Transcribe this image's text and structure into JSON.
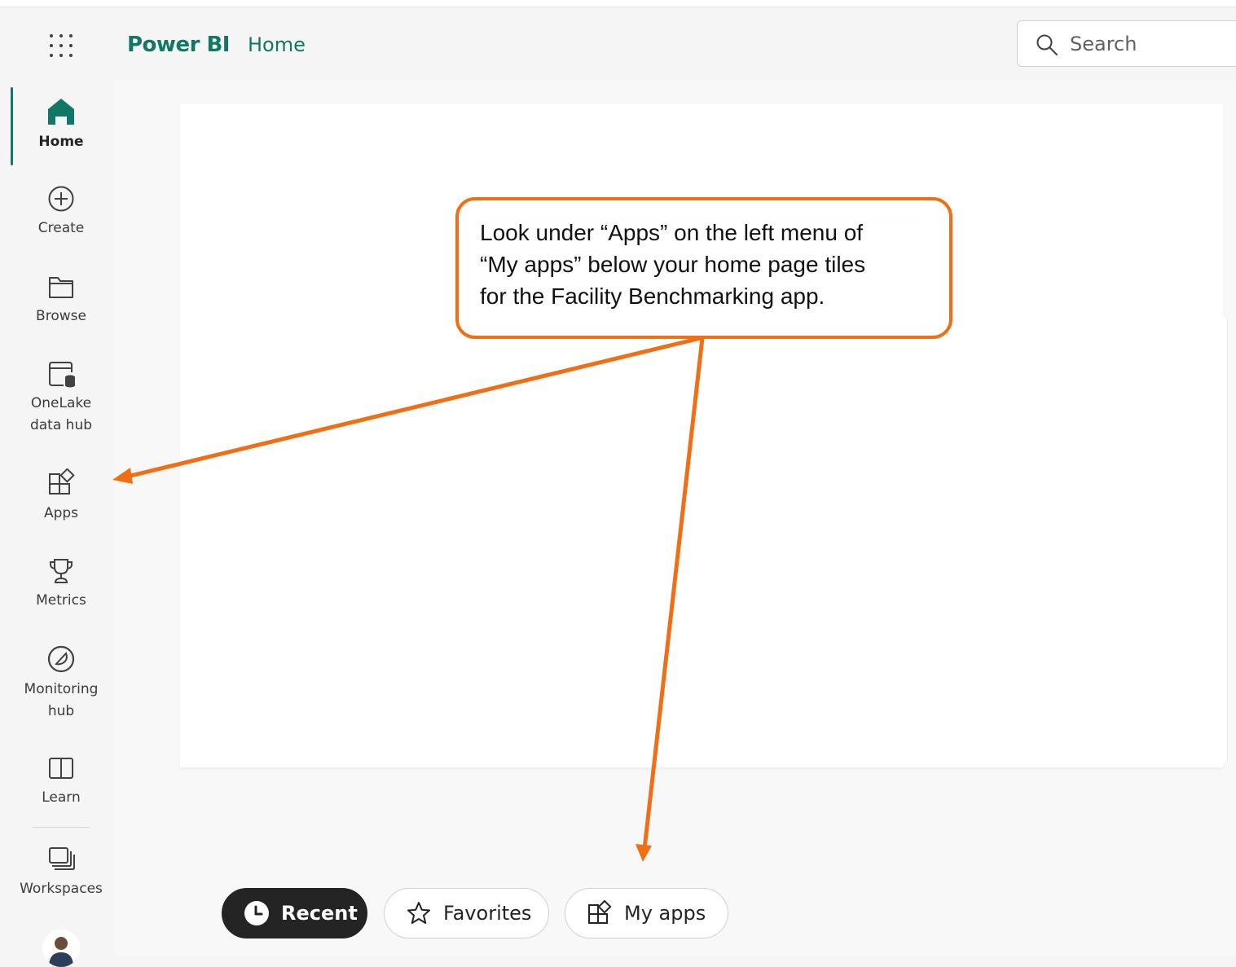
{
  "header": {
    "app_launcher_icon": "waffle-grid-icon",
    "brand": "Power BI",
    "breadcrumb": "Home",
    "search": {
      "placeholder": "Search",
      "value": "",
      "icon": "search-icon"
    }
  },
  "nav": {
    "items": [
      {
        "label": "Home",
        "icon": "home-icon",
        "active": true
      },
      {
        "label": "Create",
        "icon": "add-circle-icon"
      },
      {
        "label": "Browse",
        "icon": "folder-icon"
      },
      {
        "label": "OneLake\ndata hub",
        "icon": "database-window-icon"
      },
      {
        "label": "Apps",
        "icon": "apps-icon"
      },
      {
        "label": "Metrics",
        "icon": "trophy-icon"
      },
      {
        "label": "Monitoring\nhub",
        "icon": "gauge-icon"
      },
      {
        "label": "Learn",
        "icon": "book-icon"
      },
      {
        "label": "Workspaces",
        "icon": "workspaces-icon"
      }
    ],
    "avatar_icon": "user-avatar-icon"
  },
  "callout": {
    "text": "Look under “Apps” on the left menu of “My apps” below your home page tiles for the Facility Benchmarking app.",
    "lines": [
      "Look under “Apps” on the left menu of",
      "“My apps” below your home page tiles",
      "for the Facility Benchmarking app."
    ],
    "color": "#f26e15"
  },
  "tabs": [
    {
      "label": "Recent",
      "icon": "clock-icon",
      "selected": true
    },
    {
      "label": "Favorites",
      "icon": "star-icon",
      "selected": false
    },
    {
      "label": "My apps",
      "icon": "apps-icon",
      "selected": false
    }
  ],
  "colors": {
    "brand": "#117865",
    "annotation": "#f26e15",
    "selected_tab": "#242424"
  }
}
